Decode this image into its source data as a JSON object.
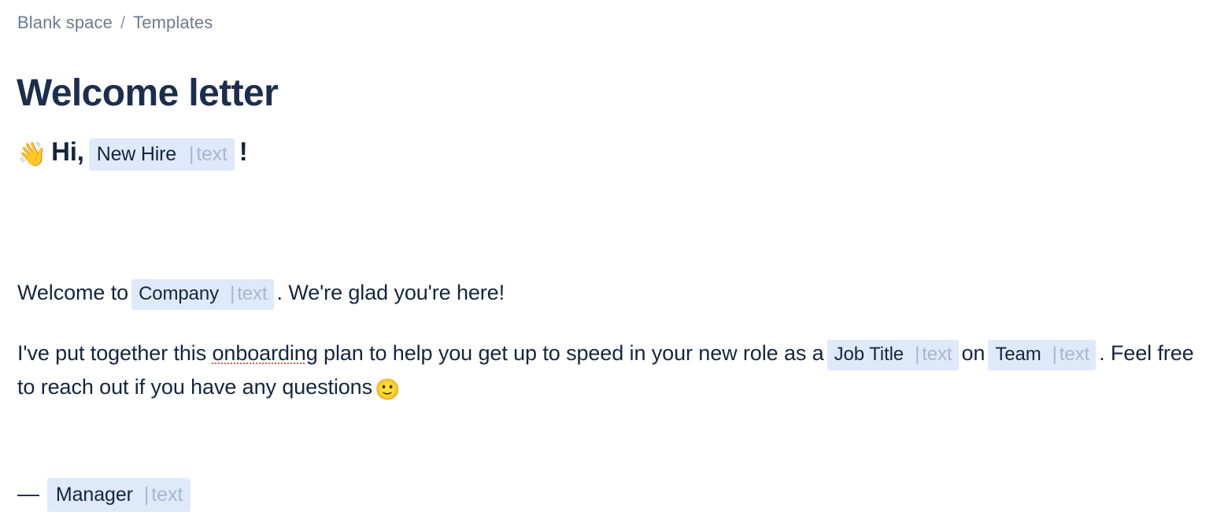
{
  "breadcrumb": {
    "items": [
      "Blank space",
      "Templates"
    ],
    "separator": "/"
  },
  "title": "Welcome letter",
  "body": {
    "greeting": {
      "wave_emoji": "👋",
      "text": "Hi,",
      "chip": {
        "label": "New Hire",
        "bar": "|",
        "type": "text"
      },
      "exclamation": "!"
    },
    "welcome_line": {
      "before": "Welcome to",
      "chip": {
        "label": "Company",
        "bar": "|",
        "type": "text"
      },
      "after": ". We're glad you're here!"
    },
    "onboarding_line": {
      "part1": "I've put together this ",
      "misspelled_word": "onboarding",
      "part2": " plan to help you get up to speed in your new role as a",
      "chip_job": {
        "label": "Job Title",
        "bar": "|",
        "type": "text"
      },
      "part3": "on",
      "chip_team": {
        "label": "Team",
        "bar": "|",
        "type": "text"
      },
      "part4": ". Feel free to reach out if you have any questions",
      "smile_emoji": "🙂"
    },
    "signoff": {
      "dash": "—",
      "chip": {
        "label": "Manager",
        "bar": "|",
        "type": "text"
      }
    }
  },
  "colors": {
    "text_primary": "#16253F",
    "title": "#1B2E4F",
    "breadcrumb": "#6B7B93",
    "chip_bg": "#DEE9FA",
    "chip_type": "#A9B7CC",
    "spellcheck_underline": "#F4533E",
    "background": "#FFFFFF"
  }
}
